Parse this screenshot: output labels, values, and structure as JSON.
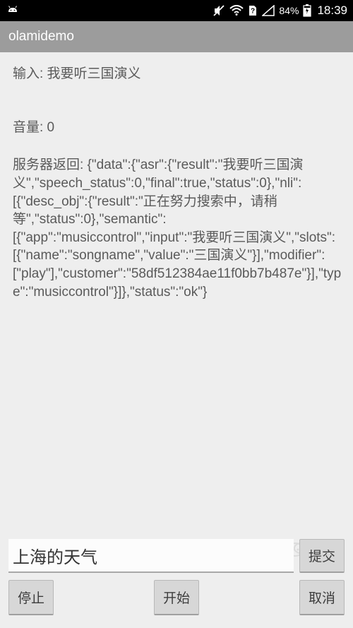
{
  "status": {
    "battery_pct": "84%",
    "time": "18:39"
  },
  "appbar": {
    "title": "olamidemo"
  },
  "content": {
    "input_label": "输入: 我要听三国演义",
    "volume_label": "音量: 0",
    "server_return": "服务器返回: {\"data\":{\"asr\":{\"result\":\"我要听三国演义\",\"speech_status\":0,\"final\":true,\"status\":0},\"nli\":[{\"desc_obj\":{\"result\":\"正在努力搜索中，请稍等\",\"status\":0},\"semantic\":[{\"app\":\"musiccontrol\",\"input\":\"我要听三国演义\",\"slots\":[{\"name\":\"songname\",\"value\":\"三国演义\"}],\"modifier\":[\"play\"],\"customer\":\"58df512384ae11f0bb7b487e\"}],\"type\":\"musiccontrol\"}]},\"status\":\"ok\"}"
  },
  "bottom": {
    "input_value": "上海的天气",
    "submit_label": "提交",
    "stop_label": "停止",
    "start_label": "开始",
    "cancel_label": "取消"
  },
  "watermark": {
    "text": "亿速云"
  }
}
